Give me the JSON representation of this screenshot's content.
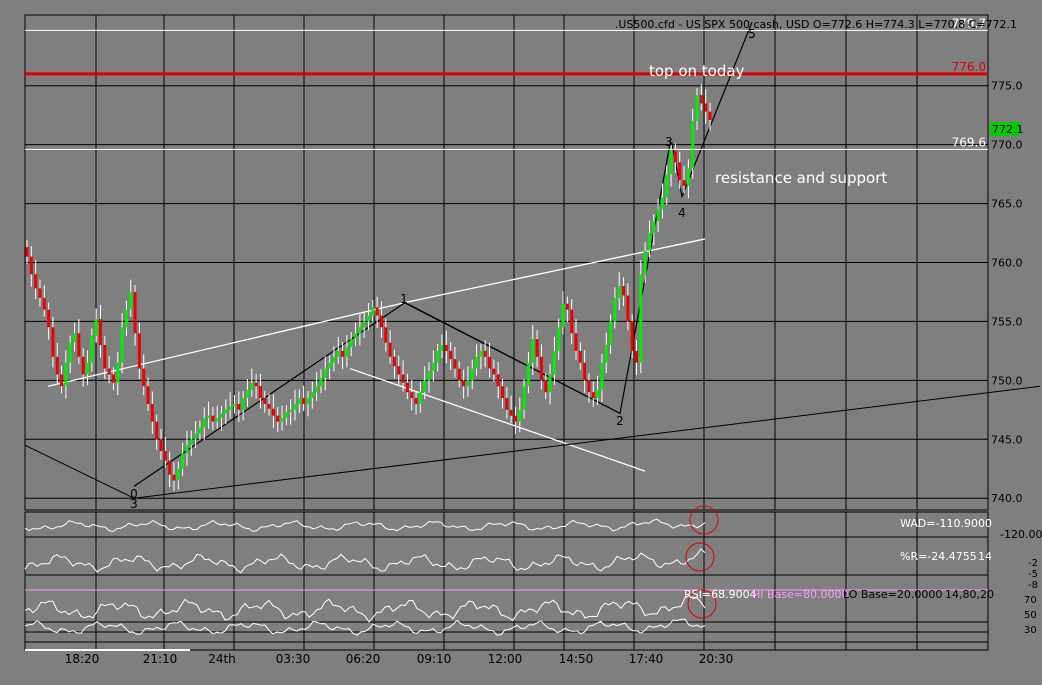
{
  "header": {
    "symbol_info": ".US500.cfd - US SPX 500 cash, USD O=772.6 H=774.3 L=770.8 C=772.1"
  },
  "chart_data": {
    "type": "candlestick",
    "price_axis": {
      "ticks": [
        "775.0",
        "770.0",
        "765.0",
        "760.0",
        "755.0",
        "750.0",
        "745.0",
        "740.0"
      ],
      "range": [
        739,
        781
      ]
    },
    "time_axis": {
      "ticks": [
        "18:20",
        "21:10",
        "24th",
        "03:30",
        "06:20",
        "09:10",
        "12:00",
        "14:50",
        "17:40",
        "20:30"
      ]
    },
    "current_price_label": "772.1",
    "levels": [
      {
        "label": "779.7",
        "value": 779.7,
        "color": "#ffffff"
      },
      {
        "label": "776.0",
        "value": 776.0,
        "color": "#dd0000"
      },
      {
        "label": "769.6",
        "value": 769.6,
        "color": "#ffffff"
      }
    ],
    "annotations": {
      "top_note": "top on today",
      "sr_note": "resistance and support"
    },
    "wave_points": [
      {
        "label": "0",
        "x": 0.157,
        "y": 741.0
      },
      {
        "label": "3",
        "x": 0.157,
        "y": 739.9
      },
      {
        "label": "1",
        "x": 0.48,
        "y": 756.6
      },
      {
        "label": "2",
        "x": 0.733,
        "y": 747.2
      },
      {
        "label": "3",
        "x": 0.791,
        "y": 770.5
      },
      {
        "label": "4",
        "x": 0.806,
        "y": 765.6
      },
      {
        "label": "5",
        "x": 0.891,
        "y": 780.4
      }
    ],
    "closes": [
      760.5,
      759.0,
      757.8,
      757.0,
      756.0,
      754.5,
      752.0,
      750.5,
      749.5,
      751.5,
      753.2,
      754.0,
      752.0,
      750.5,
      751.5,
      753.8,
      755.2,
      753.0,
      751.0,
      750.5,
      749.8,
      751.5,
      754.5,
      756.0,
      757.5,
      754.0,
      751.0,
      749.5,
      748.0,
      746.5,
      745.0,
      744.0,
      743.2,
      742.0,
      741.5,
      742.5,
      743.8,
      744.5,
      745.0,
      745.5,
      746.0,
      746.8,
      747.0,
      746.5,
      746.8,
      747.2,
      747.5,
      747.8,
      748.0,
      747.5,
      748.5,
      749.2,
      749.8,
      749.5,
      748.5,
      748.0,
      747.6,
      747.0,
      746.5,
      746.8,
      747.3,
      747.5,
      748.0,
      748.5,
      748.0,
      748.5,
      749.0,
      749.5,
      750.2,
      751.0,
      751.5,
      752.0,
      752.5,
      752.0,
      752.8,
      753.5,
      754.0,
      754.5,
      755.0,
      755.5,
      756.2,
      755.5,
      754.5,
      753.2,
      752.0,
      751.2,
      750.5,
      749.8,
      749.0,
      748.5,
      748.0,
      749.0,
      750.0,
      750.8,
      751.5,
      752.5,
      753.0,
      752.5,
      751.8,
      751.0,
      750.0,
      749.5,
      750.0,
      751.0,
      752.0,
      752.5,
      752.0,
      751.0,
      750.5,
      749.5,
      748.5,
      747.5,
      747.0,
      746.5,
      747.5,
      749.5,
      751.5,
      753.5,
      752.0,
      750.0,
      749.0,
      750.5,
      752.5,
      754.5,
      756.5,
      756.0,
      754.0,
      752.5,
      751.5,
      750.0,
      749.0,
      748.5,
      749.2,
      751.5,
      753.0,
      755.0,
      757.0,
      758.0,
      757.2,
      755.0,
      752.5,
      751.5,
      759.0,
      761.0,
      762.5,
      763.5,
      764.5,
      765.5,
      767.5,
      769.5,
      768.5,
      767.0,
      766.5,
      768.0,
      772.0,
      774.2,
      773.5,
      772.8,
      772.1
    ],
    "indicators": [
      {
        "label": "WAD=-110.9000",
        "side": "-120.00"
      },
      {
        "label": "%R=-24.4755",
        "side": "14",
        "right_ticks": [
          "-2",
          "-5",
          "-8"
        ]
      },
      {
        "label": "RSI=68.9004",
        "hi": "HI Base=80.0000",
        "lo": "LO Base=20.0000",
        "params": "14,80,20",
        "right_ticks": [
          "70",
          "50",
          "30"
        ]
      }
    ],
    "colors": {
      "background": "#7f7f7f",
      "up": "#00ee00",
      "down": "#ee0000",
      "resistance": "#dd0000"
    }
  }
}
